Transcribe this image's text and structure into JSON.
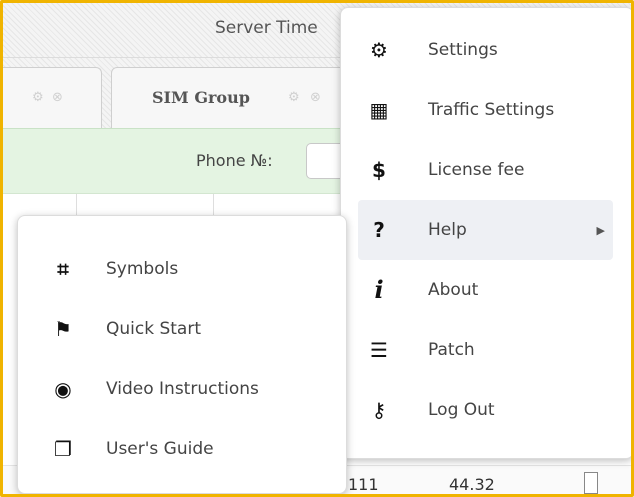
{
  "header": {
    "server_time_label": "Server Time"
  },
  "tabs": [
    {
      "label": ""
    },
    {
      "label": "SIM Group"
    }
  ],
  "filter": {
    "phone_label": "Phone №:",
    "phone_value": ""
  },
  "table": {
    "row": {
      "col1": "111",
      "col2": "44.32"
    }
  },
  "main_menu": {
    "items": [
      {
        "label": "Settings",
        "icon": "gear-icon",
        "glyph": "⚙"
      },
      {
        "label": "Traffic Settings",
        "icon": "traffic-icon",
        "glyph": "▦"
      },
      {
        "label": "License fee",
        "icon": "dollar-icon",
        "glyph": "$"
      },
      {
        "label": "Help",
        "icon": "question-icon",
        "glyph": "?",
        "submenu_arrow": "▶"
      },
      {
        "label": "About",
        "icon": "info-icon",
        "glyph": "i"
      },
      {
        "label": "Patch",
        "icon": "list-icon",
        "glyph": "☰"
      },
      {
        "label": "Log Out",
        "icon": "key-icon",
        "glyph": "⚷"
      }
    ]
  },
  "help_submenu": {
    "items": [
      {
        "label": "Symbols",
        "icon": "crop-icon",
        "glyph": "⌗"
      },
      {
        "label": "Quick Start",
        "icon": "flag-icon",
        "glyph": "⚑"
      },
      {
        "label": "Video Instructions",
        "icon": "eye-icon",
        "glyph": "◉"
      },
      {
        "label": "User's Guide",
        "icon": "copy-icon",
        "glyph": "❐"
      }
    ]
  },
  "colors": {
    "frame_border": "#f0b400",
    "filter_background": "#e4f4e2",
    "active_item_background": "#eef0f4"
  }
}
